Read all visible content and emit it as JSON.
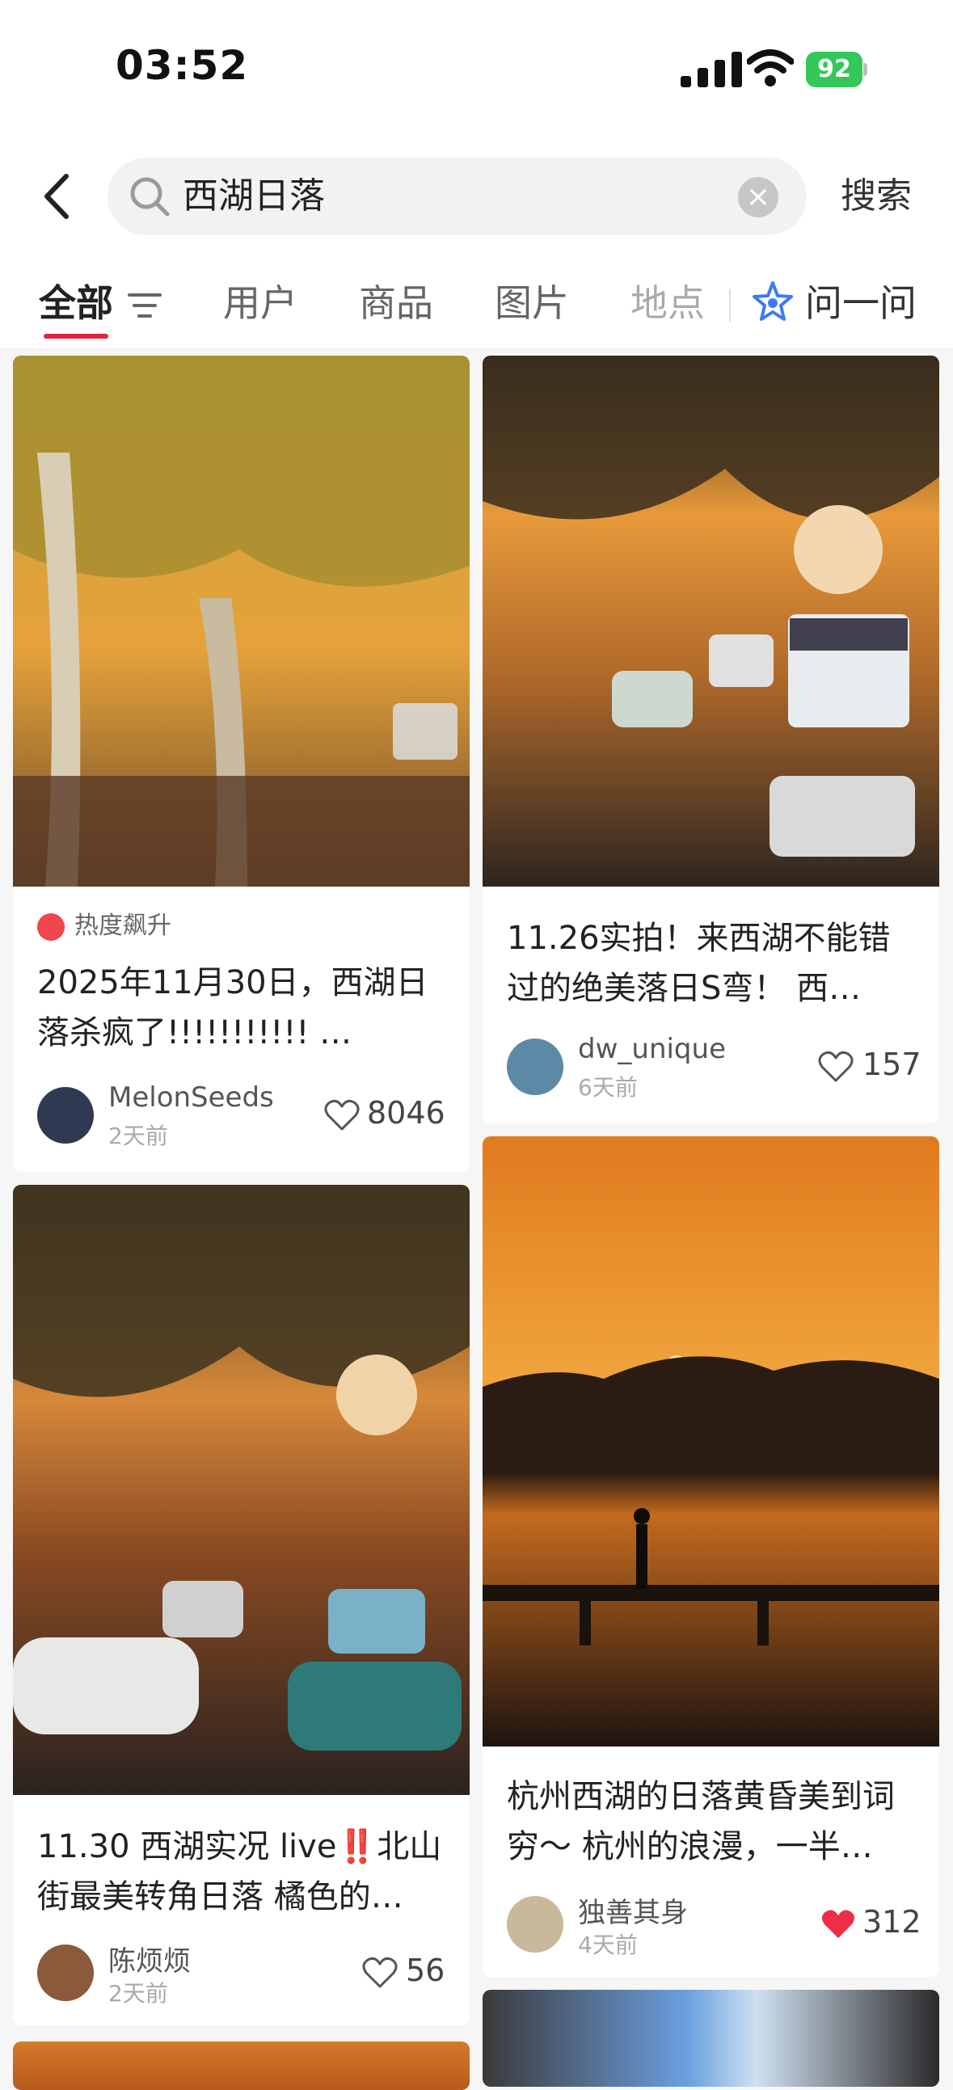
{
  "status_bar": {
    "time": "03:52",
    "battery": "92"
  },
  "search": {
    "query": "西湖日落",
    "button_label": "搜索"
  },
  "tabs": [
    {
      "label": "全部"
    },
    {
      "label": "用户"
    },
    {
      "label": "商品"
    },
    {
      "label": "图片"
    },
    {
      "label": "地点"
    },
    {
      "label": "问一问"
    }
  ],
  "posts": [
    {
      "badge": "热度飙升",
      "title_line1": "2025年11月30日，西湖日",
      "title_line2": "落杀疯了!!!!!!!!!!! …",
      "author": "MelonSeeds",
      "date": "2天前",
      "likes": "8046",
      "liked": false
    },
    {
      "title_line1": "11.26实拍！来西湖不能错",
      "title_line2": "过的绝美落日S弯！ 西…",
      "author": "dw_unique",
      "date": "6天前",
      "likes": "157",
      "liked": false
    },
    {
      "title_line1": "11.30 西湖实况 live‼️北山",
      "title_line2": "街最美转角日落 橘色的…",
      "author": "陈烦烦",
      "date": "2天前",
      "likes": "56",
      "liked": false
    },
    {
      "title_line1": "杭州西湖的日落黄昏美到词",
      "title_line2": "穷～ 杭州的浪漫，一半…",
      "author": "独善其身",
      "date": "4天前",
      "likes": "312",
      "liked": true
    }
  ]
}
